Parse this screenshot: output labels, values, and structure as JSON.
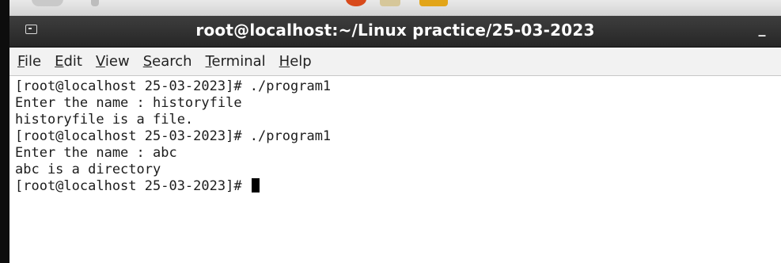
{
  "window": {
    "title": "root@localhost:~/Linux practice/25-03-2023",
    "minimize_label": "_"
  },
  "menu": {
    "items": [
      {
        "mnemonic": "F",
        "rest": "ile"
      },
      {
        "mnemonic": "E",
        "rest": "dit"
      },
      {
        "mnemonic": "V",
        "rest": "iew"
      },
      {
        "mnemonic": "S",
        "rest": "earch"
      },
      {
        "mnemonic": "T",
        "rest": "erminal"
      },
      {
        "mnemonic": "H",
        "rest": "elp"
      }
    ]
  },
  "terminal": {
    "lines": [
      "[root@localhost 25-03-2023]# ./program1",
      "Enter the name : historyfile",
      "historyfile is a file.",
      "[root@localhost 25-03-2023]# ./program1",
      "Enter the name : abc",
      "abc is a directory",
      "[root@localhost 25-03-2023]# "
    ]
  },
  "icons": {
    "terminal_window": "terminal-icon",
    "cursor": "cursor-block"
  }
}
